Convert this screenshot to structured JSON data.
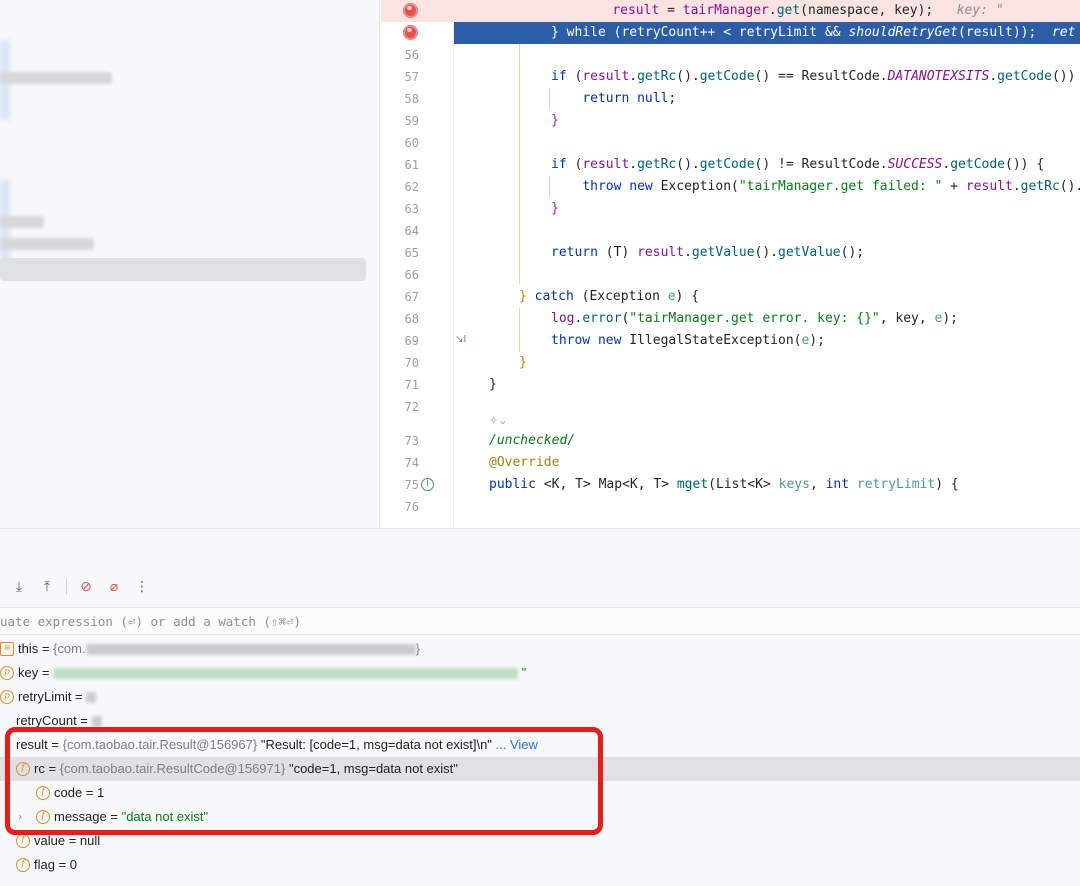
{
  "editor": {
    "lines": [
      {
        "no": "",
        "bp": true,
        "hl": "red",
        "html": "    <span class=\"var\">result</span> = <span class=\"var\">tairManager</span>.<span class=\"fn\">get</span>(namespace, key);   <span class=\"hint\">key: \"</span>"
      },
      {
        "no": "",
        "bp": true,
        "hl": "blue",
        "html": "<span class=\"kw\">} while</span> (retryCount++ &lt; retryLimit &amp;&amp; <span class=\"fn\" style=\"font-style:italic\">shouldRetryGet</span>(<span class=\"var\">result</span>));  <span class=\"hint\">ret</span>"
      },
      {
        "no": "56",
        "html": ""
      },
      {
        "no": "57",
        "html": "<span class=\"kw\">if</span> (<span class=\"var\">result</span>.<span class=\"fn\">getRc</span>().<span class=\"fn\">getCode</span>() == ResultCode.<span class=\"cst\">DATANOTEXSITS</span>.<span class=\"fn\">getCode</span>())"
      },
      {
        "no": "58",
        "html": "    <span class=\"kw\">return null</span>;"
      },
      {
        "no": "59",
        "html": "<span class=\"brace-m\">}</span>"
      },
      {
        "no": "60",
        "html": ""
      },
      {
        "no": "61",
        "html": "<span class=\"kw\">if</span> (<span class=\"var\">result</span>.<span class=\"fn\">getRc</span>().<span class=\"fn\">getCode</span>() != ResultCode.<span class=\"cst\">SUCCESS</span>.<span class=\"fn\">getCode</span>()) {"
      },
      {
        "no": "62",
        "html": "    <span class=\"kw\">throw new</span> Exception(<span class=\"str\">\"tairManager.get failed: \"</span> + <span class=\"var\">result</span>.<span class=\"fn\">getRc</span>()."
      },
      {
        "no": "63",
        "html": "<span class=\"brace-m\">}</span>"
      },
      {
        "no": "64",
        "html": ""
      },
      {
        "no": "65",
        "html": "<span class=\"kw\">return</span> (T) <span class=\"var\">result</span>.<span class=\"fn\">getValue</span>().<span class=\"fn\">getValue</span>();"
      },
      {
        "no": "66",
        "html": ""
      },
      {
        "no": "67",
        "html": "<span class=\"brace-y\">}</span> <span class=\"kw\">catch</span> (Exception <span class=\"param\">e</span>) {",
        "shift": -32
      },
      {
        "no": "68",
        "html": "<span class=\"var\">log</span>.<span class=\"fn\">error</span>(<span class=\"str\">\"tairManager.get error. key: {}\"</span>, key, <span class=\"param\">e</span>);"
      },
      {
        "no": "69",
        "html": "<span class=\"kw\">throw new</span> IllegalStateException(<span class=\"param\">e</span>);"
      },
      {
        "no": "70",
        "html": "<span class=\"brace-y\">}</span>",
        "shift": -32
      },
      {
        "no": "71",
        "html": "}",
        "shift": -62
      },
      {
        "no": "72",
        "html": ""
      },
      {
        "no": "",
        "html": ""
      },
      {
        "no": "73",
        "html": "<span class=\"str\" style=\"font-style:italic\">/unchecked/</span>",
        "shift": -62
      },
      {
        "no": "74",
        "html": "<span class=\"ann\">@Override</span>",
        "shift": -62
      },
      {
        "no": "75",
        "override": true,
        "html": "<span class=\"kw\">public</span> &lt;K, T&gt; Map&lt;K, T&gt; <span class=\"fn\">mget</span>(List&lt;K&gt; <span class=\"param\">keys</span>, <span class=\"kw\">int</span> <span class=\"param\">retryLimit</span>) {",
        "shift": -62
      },
      {
        "no": "76",
        "html": ""
      }
    ],
    "ai_hint": "✧⌄"
  },
  "debugger": {
    "toolbar": [
      {
        "name": "step-out-icon",
        "glyph": "⤓"
      },
      {
        "name": "step-up-icon",
        "glyph": "⤒"
      },
      {
        "name": "sep"
      },
      {
        "name": "view-breakpoints-icon",
        "glyph": "⊘",
        "red": true
      },
      {
        "name": "mute-breakpoints-icon",
        "glyph": "⌀",
        "red": true
      },
      {
        "name": "more-icon",
        "glyph": "⋮"
      }
    ],
    "eval_placeholder": "uate expression (⏎) or add a watch (⇧⌘⏎)",
    "variables": [
      {
        "icon": "≡",
        "sq": true,
        "x": 0,
        "html": "this = <span class=\"vtype\">{com.</span><span class=\"blur-val\" style=\"width:330px\"></span><span class=\"vtype\">}</span>"
      },
      {
        "icon": "p",
        "x": 0,
        "html": "key = <span class=\"blur-val green\" style=\"width:465px\"></span> <span class=\"vstr\">\"</span>"
      },
      {
        "icon": "p",
        "x": 0,
        "html": "retryLimit = <span class=\"blur-val\" style=\"width:10px\"></span>"
      },
      {
        "icon": "",
        "x": 0,
        "html": "retryCount = <span class=\"blur-val\" style=\"width:10px\"></span>"
      },
      {
        "icon": "",
        "x": 0,
        "html": "result = <span class=\"vtype\">{com.taobao.tair.Result@156967}</span> \"Result: [code=1, msg=data not exist]\\n\" <span class=\"vlink\">... View</span>"
      },
      {
        "icon": "f",
        "x": 16,
        "sel": true,
        "html": "rc = <span class=\"vtype\">{com.taobao.tair.ResultCode@156971}</span> \"code=1, msg=data not exist\""
      },
      {
        "icon": "f",
        "x": 36,
        "html": "code = 1"
      },
      {
        "icon": "f",
        "x": 36,
        "chev": true,
        "html": "message = <span class=\"vstr\">\"data not exist\"</span>"
      },
      {
        "icon": "f",
        "x": 16,
        "html": "value = null"
      },
      {
        "icon": "f",
        "x": 16,
        "html": "flag = 0"
      }
    ]
  }
}
